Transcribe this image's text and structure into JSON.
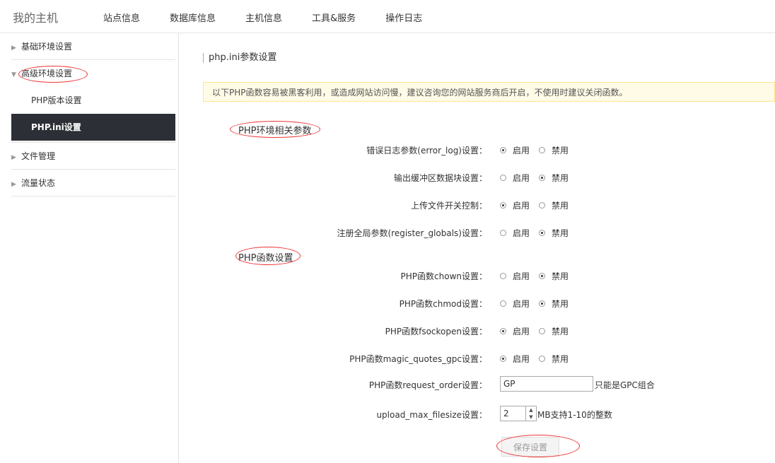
{
  "header": {
    "brand": "我的主机",
    "nav": [
      "站点信息",
      "数据库信息",
      "主机信息",
      "工具&服务",
      "操作日志"
    ]
  },
  "sidebar": {
    "basic": "基础环境设置",
    "advanced": "高级环境设置",
    "php_version": "PHP版本设置",
    "php_ini": "PHP.ini设置",
    "files": "文件管理",
    "traffic": "流量状态"
  },
  "main": {
    "section_title": "php.ini参数设置",
    "notice": "以下PHP函数容易被黑客利用，或造成网站访问慢，建议咨询您的网站服务商后开启，不使用时建议关闭函数。",
    "group_env": "PHP环境相关参数",
    "group_func": "PHP函数设置",
    "enable": "启用",
    "disable": "禁用",
    "env_rows": [
      {
        "label": "错误日志参数(error_log)设置：",
        "value": "启用"
      },
      {
        "label": "输出缓冲区数据块设置：",
        "value": "禁用"
      },
      {
        "label": "上传文件开关控制：",
        "value": "启用"
      },
      {
        "label": "注册全局参数(register_globals)设置：",
        "value": "禁用"
      }
    ],
    "func_rows": [
      {
        "label": "PHP函数chown设置：",
        "value": "禁用"
      },
      {
        "label": "PHP函数chmod设置：",
        "value": "禁用"
      },
      {
        "label": "PHP函数fsockopen设置：",
        "value": "启用"
      },
      {
        "label": "PHP函数magic_quotes_gpc设置：",
        "value": "启用"
      }
    ],
    "request_order_label": "PHP函数request_order设置：",
    "request_order_value": "GP",
    "request_order_hint": "只能是GPC组合",
    "upload_label": "upload_max_filesize设置：",
    "upload_value": "2",
    "upload_hint": "MB支持1-10的整数",
    "save_label": "保存设置"
  },
  "colors": {
    "active_bg": "#2d2f36",
    "notice_bg": "#fffbe6",
    "annotation": "#ee3333"
  }
}
